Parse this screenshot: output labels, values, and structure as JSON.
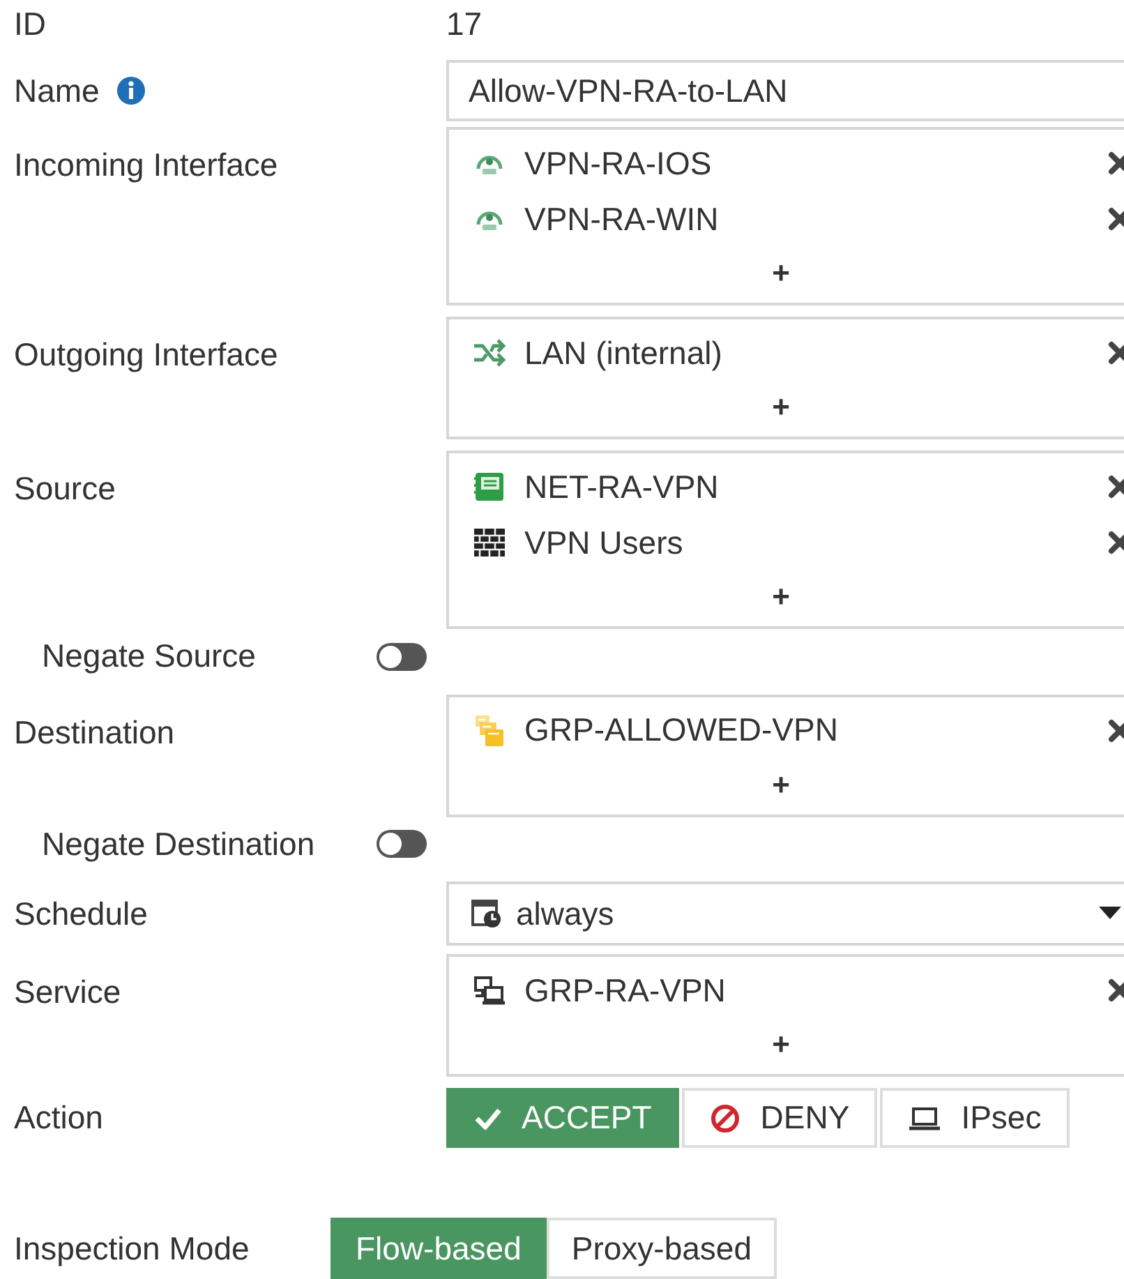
{
  "fields": [
    {
      "kind": "text",
      "label": "ID",
      "value": "17"
    },
    {
      "kind": "input",
      "label": "Name",
      "info": true,
      "value": "Allow-VPN-RA-to-LAN"
    },
    {
      "kind": "multi",
      "label": "Incoming Interface",
      "add": "+",
      "entries": [
        {
          "kind": "tunnel",
          "text": "VPN-RA-IOS"
        },
        {
          "kind": "tunnel",
          "text": "VPN-RA-WIN"
        }
      ]
    },
    {
      "kind": "multi",
      "label": "Outgoing Interface",
      "add": "+",
      "entries": [
        {
          "kind": "interface",
          "text": "LAN (internal)"
        }
      ]
    },
    {
      "kind": "multi",
      "label": "Source",
      "add": "+",
      "entries": [
        {
          "kind": "subnet",
          "text": "NET-RA-VPN"
        },
        {
          "kind": "user-group",
          "text": "VPN Users"
        }
      ]
    },
    {
      "kind": "toggle",
      "label": "Negate Source",
      "on": false
    },
    {
      "kind": "multi",
      "label": "Destination",
      "add": "+",
      "entries": [
        {
          "kind": "address-group",
          "text": "GRP-ALLOWED-VPN"
        }
      ]
    },
    {
      "kind": "toggle",
      "label": "Negate Destination",
      "on": false
    },
    {
      "kind": "select",
      "label": "Schedule",
      "value": "always"
    },
    {
      "kind": "multi",
      "label": "Service",
      "add": "+",
      "entries": [
        {
          "kind": "service-group",
          "text": "GRP-RA-VPN"
        }
      ]
    },
    {
      "kind": "action",
      "label": "Action",
      "options": [
        {
          "kind": "accept",
          "label": "ACCEPT",
          "selected": true
        },
        {
          "kind": "deny",
          "label": "DENY",
          "selected": false
        },
        {
          "kind": "ipsec",
          "label": "IPsec",
          "selected": false
        }
      ]
    },
    {
      "kind": "mode",
      "label": "Inspection Mode",
      "options": [
        {
          "label": "Flow-based",
          "selected": true
        },
        {
          "label": "Proxy-based",
          "selected": false
        }
      ]
    }
  ]
}
